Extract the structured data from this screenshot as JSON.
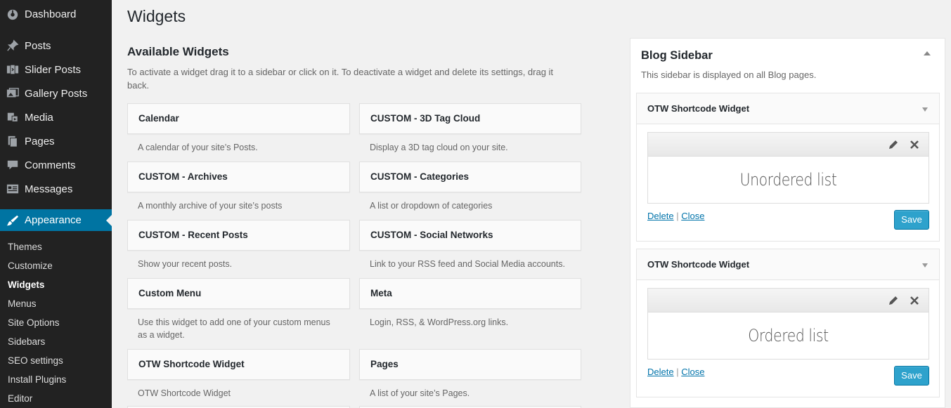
{
  "menu": {
    "items": [
      {
        "label": "Dashboard",
        "icon": "dashboard-icon"
      },
      {
        "label": "Posts",
        "icon": "pin-icon"
      },
      {
        "label": "Slider Posts",
        "icon": "slider-icon"
      },
      {
        "label": "Gallery Posts",
        "icon": "gallery-icon"
      },
      {
        "label": "Media",
        "icon": "media-icon"
      },
      {
        "label": "Pages",
        "icon": "pages-icon"
      },
      {
        "label": "Comments",
        "icon": "comment-icon"
      },
      {
        "label": "Messages",
        "icon": "messages-icon"
      },
      {
        "label": "Appearance",
        "icon": "brush-icon"
      }
    ],
    "submenu": [
      "Themes",
      "Customize",
      "Widgets",
      "Menus",
      "Site Options",
      "Sidebars",
      "SEO settings",
      "Install Plugins",
      "Editor"
    ]
  },
  "page": {
    "title": "Widgets",
    "available_title": "Available Widgets",
    "available_desc": "To activate a widget drag it to a sidebar or click on it. To deactivate a widget and delete its settings, drag it back."
  },
  "widgets": [
    {
      "title": "Calendar",
      "desc": "A calendar of your site’s Posts."
    },
    {
      "title": "CUSTOM - 3D Tag Cloud",
      "desc": "Display a 3D tag cloud on your site."
    },
    {
      "title": "CUSTOM - Archives",
      "desc": "A monthly archive of your site’s posts"
    },
    {
      "title": "CUSTOM - Categories",
      "desc": "A list or dropdown of categories"
    },
    {
      "title": "CUSTOM - Recent Posts",
      "desc": "Show your recent posts."
    },
    {
      "title": "CUSTOM - Social Networks",
      "desc": "Link to your RSS feed and Social Media accounts."
    },
    {
      "title": "Custom Menu",
      "desc": "Use this widget to add one of your custom menus as a widget."
    },
    {
      "title": "Meta",
      "desc": "Login, RSS, & WordPress.org links."
    },
    {
      "title": "OTW Shortcode Widget",
      "desc": "OTW Shortcode Widget"
    },
    {
      "title": "Pages",
      "desc": "A list of your site’s Pages."
    }
  ],
  "sidebar": {
    "title": "Blog Sidebar",
    "desc": "This sidebar is displayed on all Blog pages.",
    "widgets": [
      {
        "title": "OTW Shortcode Widget",
        "content": "Unordered list",
        "delete": "Delete",
        "sep": "|",
        "close": "Close",
        "save": "Save"
      },
      {
        "title": "OTW Shortcode Widget",
        "content": "Ordered list",
        "delete": "Delete",
        "sep": "|",
        "close": "Close",
        "save": "Save"
      }
    ]
  },
  "colors": {
    "menu_bg": "#222222",
    "accent": "#0074a2",
    "button": "#2ea2cc",
    "page_bg": "#f1f1f1"
  }
}
